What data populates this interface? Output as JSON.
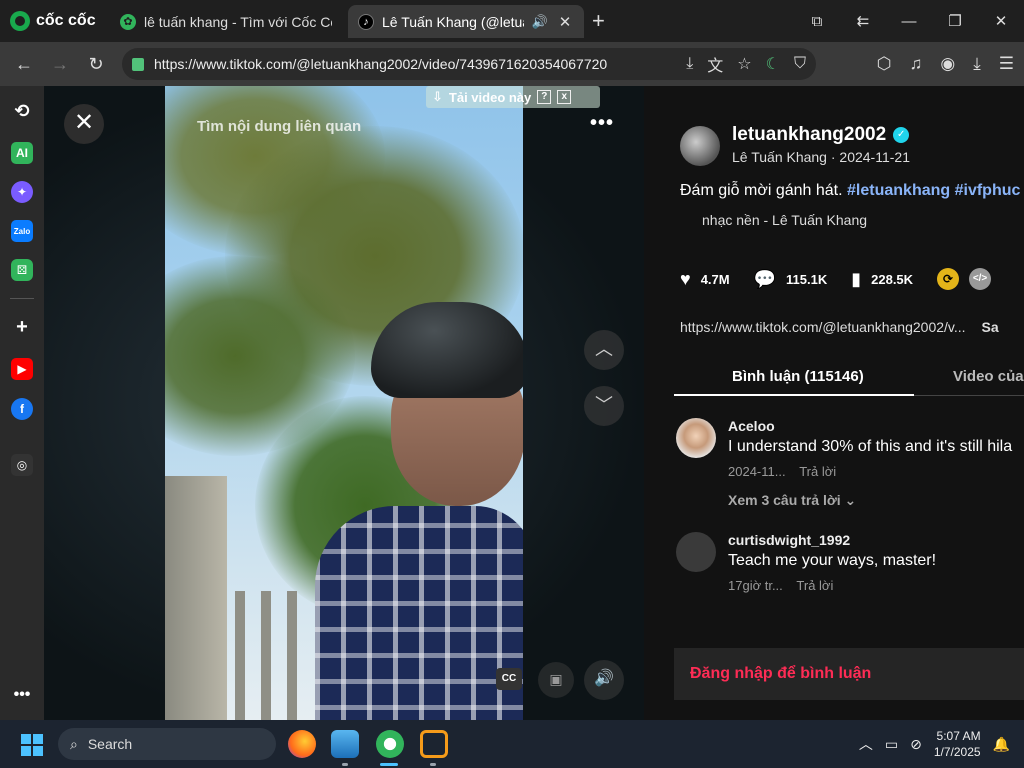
{
  "browser": {
    "brand": "cốc cốc",
    "tabs": [
      {
        "title": "lê tuấn khang - Tìm với Cốc Cốc",
        "icon": "coccoc-leaf-icon",
        "active": false
      },
      {
        "title": "Lê Tuấn Khang (@letuank",
        "icon": "tiktok-icon",
        "active": true
      }
    ],
    "url": "https://www.tiktok.com/@letuankhang2002/video/7439671620354067720"
  },
  "video": {
    "overlay_text": "Tìm nội dung liên quan",
    "download_bar": "Tải video này",
    "download_help": "?",
    "download_close": "x",
    "cc_label": "CC"
  },
  "panel": {
    "username": "letuankhang2002",
    "display_line": "Lê Tuấn Khang · 2024-11-21",
    "caption_plain": "Đám giỗ mời gánh hát.",
    "caption_tags": "#letuankhang #ivfphuc",
    "music": "nhạc nền - Lê Tuấn Khang",
    "stats": {
      "likes": "4.7M",
      "comments": "115.1K",
      "saves": "228.5K"
    },
    "link": "https://www.tiktok.com/@letuankhang2002/v...",
    "link_action": "Sa",
    "tabs": {
      "comments": "Bình luận (115146)",
      "videos": "Video của n"
    },
    "comments": [
      {
        "user": "Aceloo",
        "text": "I understand 30% of this and it's still hila",
        "time": "2024-11...",
        "reply": "Trả lời",
        "replies": "Xem 3 câu trả lời ⌄"
      },
      {
        "user": "curtisdwight_1992",
        "text": "Teach me your ways, master!",
        "time": "17giờ tr...",
        "reply": "Trả lời"
      }
    ],
    "login_prompt": "Đăng nhập để bình luận"
  },
  "taskbar": {
    "search_label": "Search",
    "time": "5:07 AM",
    "date": "1/7/2025"
  },
  "colors": {
    "accent_red": "#fe2c55",
    "hashtag_blue": "#8ab4f8",
    "verified": "#20d5ec"
  }
}
